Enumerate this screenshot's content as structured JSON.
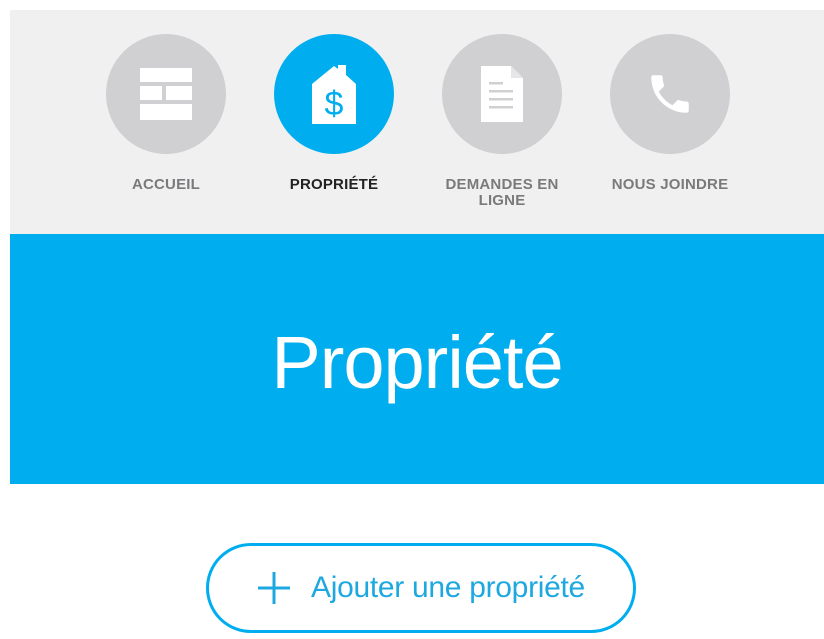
{
  "nav": {
    "items": [
      {
        "label": "ACCUEIL",
        "icon": "home-grid-icon",
        "active": false
      },
      {
        "label": "PROPRIÉTÉ",
        "icon": "house-dollar-icon",
        "active": true
      },
      {
        "label_line1": "DEMANDES EN",
        "label_line2": "LIGNE",
        "icon": "document-icon",
        "active": false
      },
      {
        "label": "NOUS JOINDRE",
        "icon": "phone-icon",
        "active": false
      }
    ]
  },
  "hero": {
    "title": "Propriété"
  },
  "actions": {
    "add_property_label": "Ajouter une propriété"
  },
  "colors": {
    "accent": "#00aeef",
    "nav_background": "#f0f0f1",
    "inactive_circle": "#d0d0d2",
    "inactive_label": "#7a7a7c",
    "active_label": "#222222"
  }
}
